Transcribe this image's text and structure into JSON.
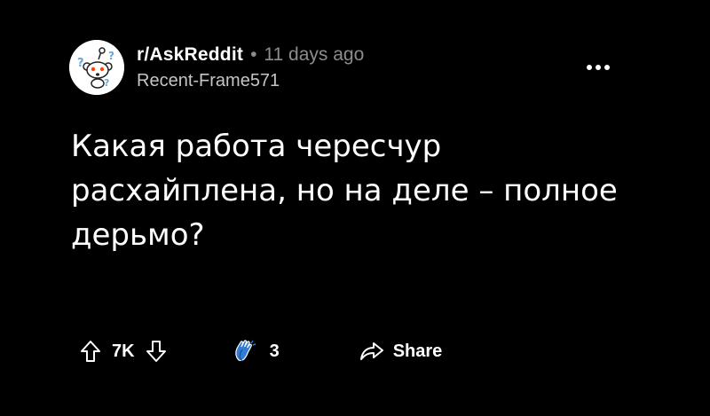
{
  "post": {
    "subreddit": "r/AskReddit",
    "separator": "•",
    "time_ago": "11 days ago",
    "author": "Recent-Frame571",
    "title": "Какая работа чересчур расхайплена, но на деле – полное дерьмо?",
    "score": "7K",
    "comments_count": "3",
    "share_label": "Share"
  },
  "icons": {
    "avatar": "askreddit-snoo-icon",
    "more": "more-options-icon",
    "upvote": "upvote-arrow-icon",
    "downvote": "downvote-arrow-icon",
    "award": "clapping-hands-award-icon",
    "share": "share-arrow-icon"
  },
  "colors": {
    "background": "#000000",
    "text_primary": "#ffffff",
    "text_secondary": "#8a8d90",
    "award_blue": "#2f7bd6"
  }
}
